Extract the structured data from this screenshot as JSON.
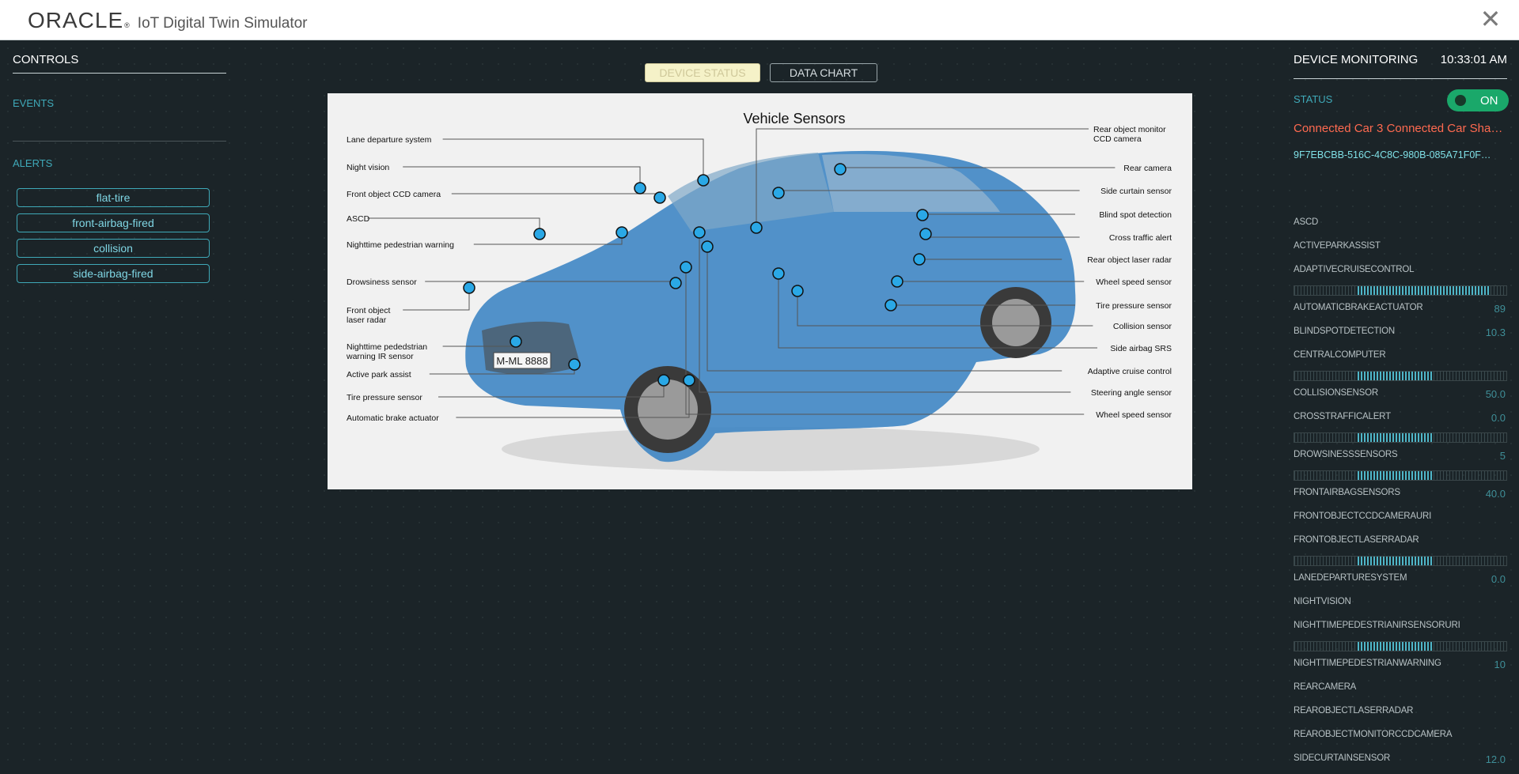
{
  "header": {
    "logo": "ORACLE",
    "logo_mark": "®",
    "subtitle": "IoT Digital Twin Simulator",
    "close_icon": "close-icon"
  },
  "controls": {
    "title": "CONTROLS",
    "events_label": "EVENTS",
    "alerts_label": "ALERTS",
    "alerts": [
      "flat-tire",
      "front-airbag-fired",
      "collision",
      "side-airbag-fired"
    ]
  },
  "tabs": [
    {
      "label": "DEVICE STATUS",
      "active": true
    },
    {
      "label": "DATA CHART",
      "active": false
    }
  ],
  "diagram": {
    "title": "Vehicle Sensors",
    "left_labels": [
      "Lane departure system",
      "Night vision",
      "Front object CCD camera",
      "ASCD",
      "Nighttime pedestrian warning",
      "Drowsiness sensor",
      [
        "Front object",
        "laser radar"
      ],
      [
        "Nighttime pededstrian",
        "warning IR sensor"
      ],
      "Active park assist",
      "Tire pressure sensor",
      "Automatic brake actuator"
    ],
    "right_labels": [
      [
        "Rear object monitor",
        "CCD camera"
      ],
      "Rear camera",
      "Side curtain sensor",
      "Blind spot detection",
      "Cross traffic alert",
      "Rear object laser radar",
      "Wheel speed sensor",
      "Tire pressure sensor",
      "Collision sensor",
      "Side airbag SRS",
      "Adaptive cruise control",
      "Steering angle sensor",
      "Wheel speed sensor"
    ],
    "plate": "M-ML 8888",
    "car_color": "#3f86c4",
    "marker_color": "#2aa8e6"
  },
  "monitor": {
    "title": "DEVICE MONITORING",
    "time": "10:33:01 AM",
    "status_label": "STATUS",
    "toggle_label": "ON",
    "toggle_on": true,
    "device_name": "Connected Car 3 Connected Car Sha…",
    "device_id": "9F7EBCBB-516C-4C8C-980B-085A71F0F…",
    "sensors": [
      {
        "name": "ASCD",
        "value": ""
      },
      {
        "name": "ACTIVEPARKASSIST",
        "value": ""
      },
      {
        "name": "ADAPTIVECRUISECONTROL",
        "value": ""
      },
      {
        "name": "AUTOMATICBRAKEACTUATOR",
        "value": "89",
        "bar": 0.89
      },
      {
        "name": "BLINDSPOTDETECTION",
        "value": "10.3"
      },
      {
        "name": "CENTRALCOMPUTER",
        "value": ""
      },
      {
        "name": "COLLISIONSENSOR",
        "value": "50.0",
        "bar": 0.5
      },
      {
        "name": "CROSSTRAFFICALERT",
        "value": "0.0"
      },
      {
        "name": "DROWSINESSSENSORS",
        "value": "5",
        "bar": 0.5
      },
      {
        "name": "FRONTAIRBAGSENSORS",
        "value": "40.0",
        "bar": 0.5
      },
      {
        "name": "FRONTOBJECTCCDCAMERAURI",
        "value": ""
      },
      {
        "name": "FRONTOBJECTLASERRADAR",
        "value": ""
      },
      {
        "name": "LANEDEPARTURESYSTEM",
        "value": "0.0",
        "bar": 0.5
      },
      {
        "name": "NIGHTVISION",
        "value": ""
      },
      {
        "name": "NIGHTTIMEPEDESTRIANIRSENSORURI",
        "value": ""
      },
      {
        "name": "NIGHTTIMEPEDESTRIANWARNING",
        "value": "10",
        "bar": 0.5
      },
      {
        "name": "REARCAMERA",
        "value": ""
      },
      {
        "name": "REAROBJECTLASERRADAR",
        "value": ""
      },
      {
        "name": "REAROBJECTMONITORCCDCAMERA",
        "value": ""
      },
      {
        "name": "SIDECURTAINSENSOR",
        "value": "12.0"
      }
    ]
  }
}
